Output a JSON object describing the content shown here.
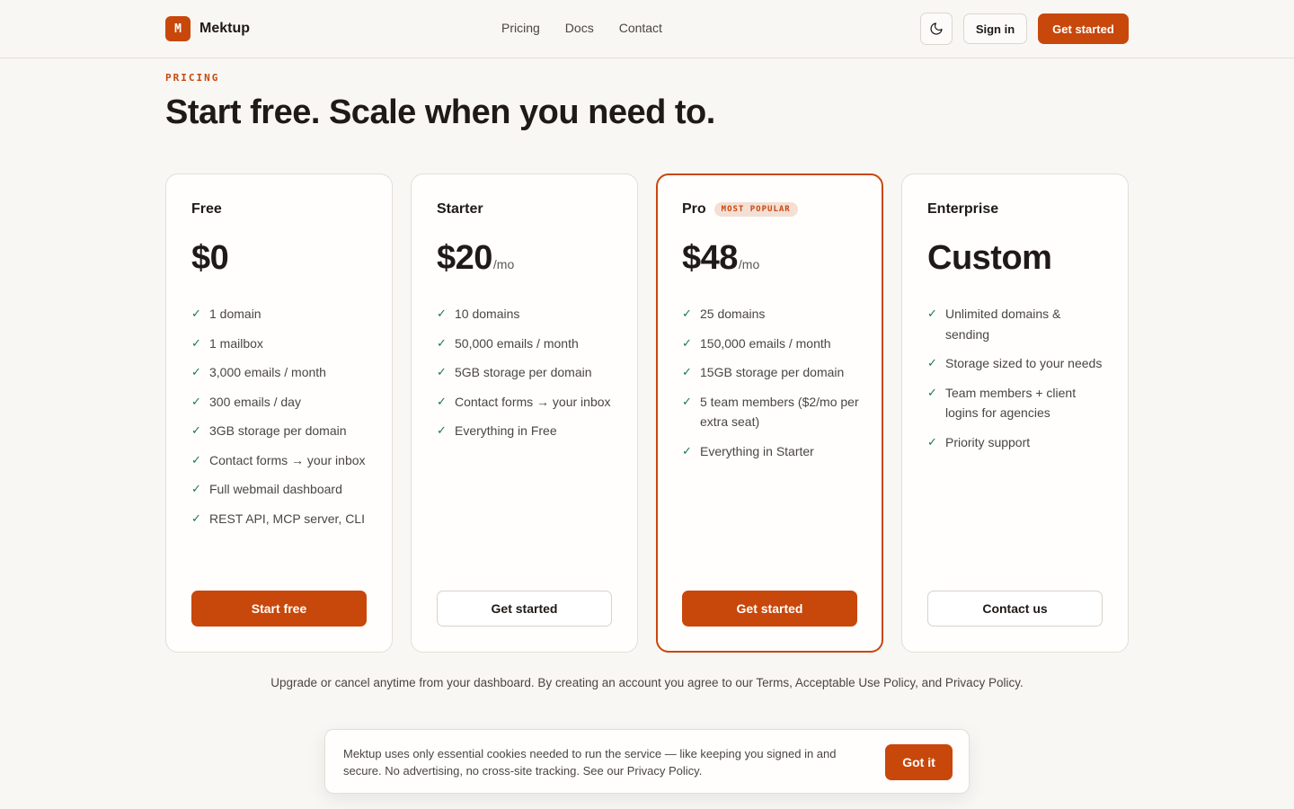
{
  "brand": {
    "logo_letter": "M",
    "name": "Mektup",
    "accent_color": "#c8470b"
  },
  "nav": {
    "items": [
      "Pricing",
      "Docs",
      "Contact"
    ]
  },
  "header_actions": {
    "theme_icon": "moon-icon",
    "sign_in": "Sign in",
    "get_started": "Get started"
  },
  "hero": {
    "eyebrow": "PRICING",
    "title": "Start free. Scale when you need to."
  },
  "plans": [
    {
      "name": "Free",
      "price": "$0",
      "unit": "",
      "features": [
        "1 domain",
        "1 mailbox",
        "3,000 emails / month",
        "300 emails / day",
        "3GB storage per domain",
        "Contact forms → your inbox",
        "Full webmail dashboard",
        "REST API, MCP server, CLI"
      ],
      "button": "Start free"
    },
    {
      "name": "Starter",
      "price": "$20",
      "unit": "/mo",
      "features": [
        "10 domains",
        "50,000 emails / month",
        "5GB storage per domain",
        "Contact forms → your inbox",
        "Everything in Free"
      ],
      "button": "Get started"
    },
    {
      "name": "Pro",
      "badge": "MOST POPULAR",
      "price": "$48",
      "unit": "/mo",
      "features": [
        "25 domains",
        "150,000 emails / month",
        "15GB storage per domain",
        "5 team members ($2/mo per extra seat)",
        "Everything in Starter"
      ],
      "button": "Get started"
    },
    {
      "name": "Enterprise",
      "price": "Custom",
      "unit": "",
      "features": [
        "Unlimited domains & sending",
        "Storage sized to your needs",
        "Team members + client logins for agencies",
        "Priority support"
      ],
      "button": "Contact us"
    }
  ],
  "check_glyph": "✓",
  "footnote": "Upgrade or cancel anytime from your dashboard. By creating an account you agree to our Terms, Acceptable Use Policy, and Privacy Policy.",
  "cookie": {
    "text": "Mektup uses only essential cookies needed to run the service — like keeping you signed in and secure. No advertising, no cross-site tracking. See our Privacy Policy.",
    "button": "Got it"
  }
}
